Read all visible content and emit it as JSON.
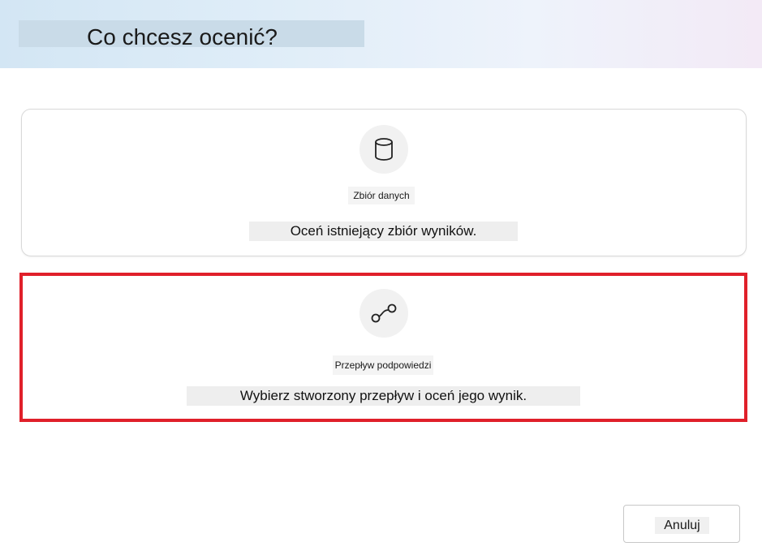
{
  "dialog": {
    "title": "Co chcesz ocenić?"
  },
  "options": [
    {
      "icon": "database-icon",
      "label": "Zbiór danych",
      "description": "Oceń istniejący zbiór wyników."
    },
    {
      "icon": "flow-icon",
      "label": "Przepływ podpowiedzi",
      "description": "Wybierz stworzony przepływ i oceń jego wynik."
    }
  ],
  "footer": {
    "cancel_label": "Anuluj"
  },
  "colors": {
    "selected_outline": "#e0202a",
    "header_gradient_start": "#d3e6f4",
    "header_gradient_end": "#f3eaf6"
  }
}
